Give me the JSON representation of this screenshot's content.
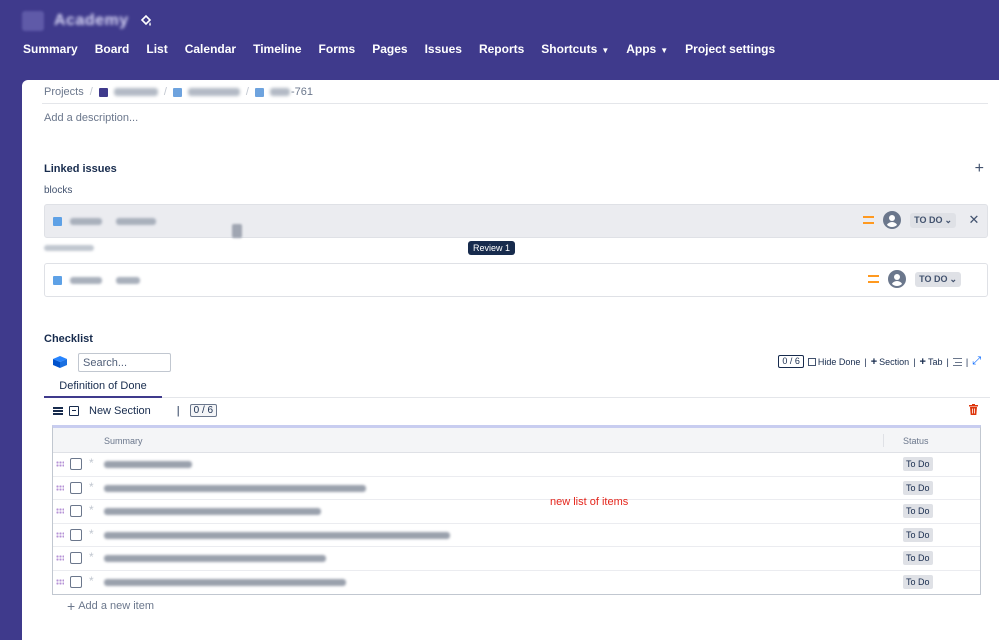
{
  "header": {
    "brand_suffix": "Academy",
    "nav": [
      {
        "label": "Summary"
      },
      {
        "label": "Board"
      },
      {
        "label": "List"
      },
      {
        "label": "Calendar"
      },
      {
        "label": "Timeline"
      },
      {
        "label": "Forms"
      },
      {
        "label": "Pages"
      },
      {
        "label": "Issues"
      },
      {
        "label": "Reports"
      },
      {
        "label": "Shortcuts",
        "dropdown": true
      },
      {
        "label": "Apps",
        "dropdown": true
      },
      {
        "label": "Project settings"
      }
    ]
  },
  "breadcrumb": {
    "root": "Projects",
    "issue_suffix": "-761"
  },
  "description_placeholder": "Add a description...",
  "linked_issues": {
    "title": "Linked issues",
    "relation": "blocks",
    "rows": [
      {
        "status": "TO DO",
        "priority": "medium"
      },
      {
        "status": "TO DO",
        "priority": "medium"
      }
    ],
    "tooltip": "Review 1"
  },
  "checklist": {
    "title": "Checklist",
    "search_placeholder": "Search...",
    "count": "0 / 6",
    "hide_done": "Hide Done",
    "add_section": "Section",
    "add_tab": "Tab",
    "tab": "Definition of Done",
    "section_name": "New Section",
    "section_count": "0 / 6",
    "columns": {
      "summary": "Summary",
      "status": "Status"
    },
    "items": [
      {
        "status": "To Do"
      },
      {
        "status": "To Do"
      },
      {
        "status": "To Do"
      },
      {
        "status": "To Do"
      },
      {
        "status": "To Do"
      },
      {
        "status": "To Do"
      }
    ],
    "annotation": "new list of items",
    "add_item": "Add a new item"
  },
  "colors": {
    "header_bg": "#3f3a8c",
    "priority": "#ff991f",
    "annotation": "#e5251b",
    "delete": "#de350b"
  }
}
